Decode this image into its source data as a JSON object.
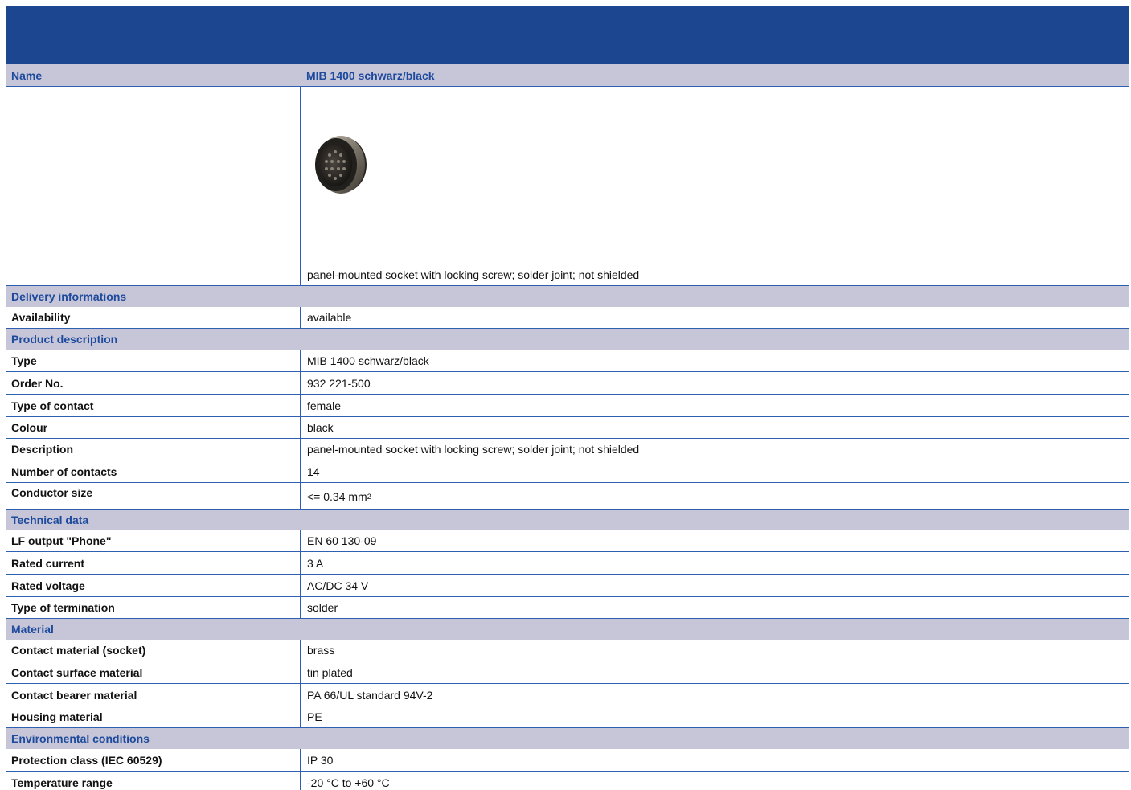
{
  "header": {
    "name_label": "Name",
    "name_value": "MIB 1400 schwarz/black"
  },
  "image_caption": "panel-mounted socket with locking screw; solder joint; not shielded",
  "sections": {
    "delivery": {
      "title": "Delivery informations",
      "rows": [
        {
          "label": "Availability",
          "value": "available"
        }
      ]
    },
    "product": {
      "title": "Product description",
      "rows": [
        {
          "label": "Type",
          "value": "MIB 1400 schwarz/black"
        },
        {
          "label": "Order No.",
          "value": "932 221-500"
        },
        {
          "label": "Type of contact",
          "value": "female"
        },
        {
          "label": "Colour",
          "value": "black"
        },
        {
          "label": "Description",
          "value": "panel-mounted socket with locking screw; solder joint; not shielded"
        },
        {
          "label": "Number of contacts",
          "value": "14"
        },
        {
          "label": "Conductor size",
          "value": "<= 0.34 mm",
          "superscript": "2"
        }
      ]
    },
    "technical": {
      "title": "Technical data",
      "rows": [
        {
          "label": "LF output \"Phone\"",
          "value": "EN 60 130-09"
        },
        {
          "label": "Rated current",
          "value": "3 A"
        },
        {
          "label": "Rated voltage",
          "value": "AC/DC 34 V"
        },
        {
          "label": "Type of termination",
          "value": "solder"
        }
      ]
    },
    "material": {
      "title": "Material",
      "rows": [
        {
          "label": "Contact material (socket)",
          "value": "brass"
        },
        {
          "label": "Contact surface material",
          "value": "tin plated"
        },
        {
          "label": "Contact bearer material",
          "value": "PA 66/UL standard 94V-2"
        },
        {
          "label": "Housing material",
          "value": "PE"
        }
      ]
    },
    "environment": {
      "title": "Environmental conditions",
      "rows": [
        {
          "label": "Protection class (IEC 60529)",
          "value": "IP 30"
        },
        {
          "label": "Temperature range",
          "value": "-20 °C to +60 °C"
        }
      ]
    }
  },
  "colors": {
    "header_band": "#1d4690",
    "section_bg": "#c7c6d9",
    "section_text": "#1d4a9c",
    "grid_line": "#2f5fb0"
  },
  "icons": {
    "product_image": "circular-connector-socket-photo"
  }
}
